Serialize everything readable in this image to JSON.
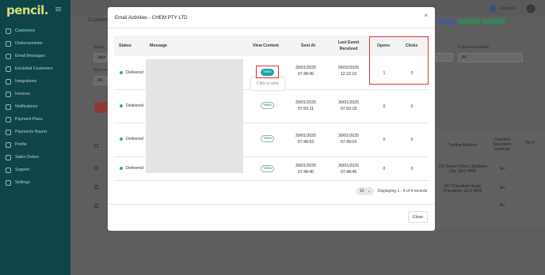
{
  "app": {
    "logo": "pencil."
  },
  "sidebar": {
    "items": [
      {
        "label": "Customers",
        "icon": "customers-icon",
        "active": true
      },
      {
        "label": "Disbursements",
        "icon": "disbursements-icon"
      },
      {
        "label": "Email Messages",
        "icon": "email-icon"
      },
      {
        "label": "Excluded Customers",
        "icon": "excluded-icon"
      },
      {
        "label": "Integrations",
        "icon": "integrations-icon"
      },
      {
        "label": "Invoices",
        "icon": "invoices-icon"
      },
      {
        "label": "Notifications",
        "icon": "bell-icon"
      },
      {
        "label": "Payment Plans",
        "icon": "plans-icon"
      },
      {
        "label": "Payments Report",
        "icon": "report-icon"
      },
      {
        "label": "Profile",
        "icon": "user-icon"
      },
      {
        "label": "Sales Orders",
        "icon": "orders-icon"
      },
      {
        "label": "Support",
        "icon": "support-icon"
      },
      {
        "label": "Settings",
        "icon": "gear-icon"
      }
    ]
  },
  "background": {
    "title": "Custom",
    "status_label": "Status",
    "status_value": "Appr",
    "auto_label": "Auto-un",
    "auto_value": "All",
    "failure_label": "Failure Escalated",
    "failure_value": "All",
    "country": "Australia",
    "table": {
      "col_trading": "Trading Address",
      "col_directors": "Directors have been bankrupt",
      "col_re": "Re D",
      "rows": [
        {
          "address": "100 Queen Street, Brisbane City, QLD 4000",
          "directors": "No"
        },
        {
          "address": "347 Chevallum Road, Chevallum, QLD 4555",
          "directors": "No"
        },
        {
          "address": "",
          "directors": "No"
        }
      ]
    }
  },
  "modal": {
    "title": "Email Activities - CHEM PTY LTD",
    "close_icon": "×",
    "columns": {
      "status": "Status",
      "message": "Message",
      "view_content": "View Content",
      "sent_at": "Sent At",
      "last_event": "Last Event Received",
      "opens": "Opens",
      "clicks": "Clicks"
    },
    "rows": [
      {
        "status": "Delivered",
        "view": "View",
        "sent_date": "30/01/2025",
        "sent_time": "07:48:45",
        "last_date": "06/02/2025",
        "last_time": "12:22:10",
        "opens": "1",
        "clicks": "0"
      },
      {
        "status": "Delivered",
        "view": "View",
        "sent_date": "30/01/2025",
        "sent_time": "07:50:11",
        "last_date": "30/01/2025",
        "last_time": "07:50:18",
        "opens": "0",
        "clicks": "0"
      },
      {
        "status": "Delivered",
        "view": "View",
        "sent_date": "30/01/2025",
        "sent_time": "07:48:53",
        "last_date": "30/01/2025",
        "last_time": "07:49:04",
        "opens": "0",
        "clicks": "0"
      },
      {
        "status": "Delivered",
        "view": "View",
        "sent_date": "30/01/2025",
        "sent_time": "07:48:40",
        "last_date": "30/01/2025",
        "last_time": "07:48:45",
        "opens": "0",
        "clicks": "0"
      }
    ],
    "tooltip": "Click to view",
    "pager": {
      "page_size": "10",
      "info": "Displaying 1 - 4 of 4 records"
    },
    "close_label": "Close"
  },
  "colors": {
    "sidebar": "#0f4449",
    "accent": "#17a6b4",
    "delivered": "#2fb27b",
    "highlight": "#e8312f"
  }
}
